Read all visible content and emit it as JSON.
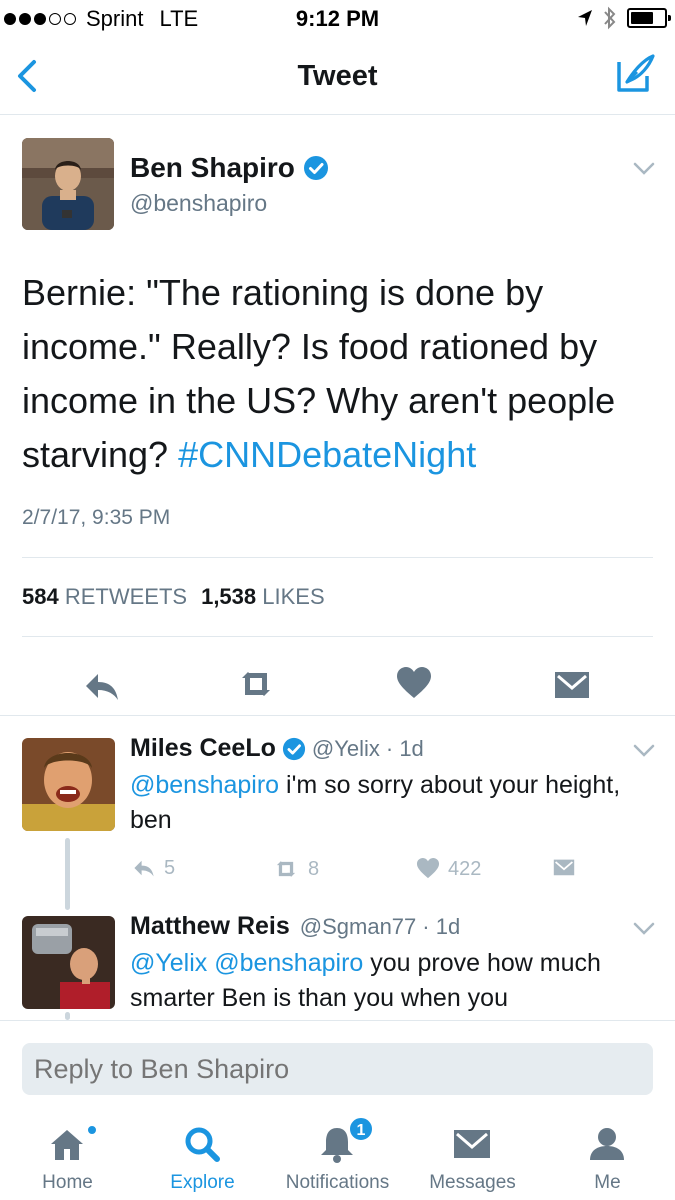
{
  "status_bar": {
    "carrier": "Sprint",
    "network": "LTE",
    "time": "9:12 PM"
  },
  "nav": {
    "title": "Tweet"
  },
  "tweet": {
    "author_name": "Ben Shapiro",
    "author_handle": "@benshapiro",
    "text_main": "Bernie: \"The rationing is done by income.\" Really? Is food rationed by income in the US? Why aren't people starving? ",
    "hashtag": "#CNNDebateNight",
    "timestamp": "2/7/17, 9:35 PM",
    "retweets_count": "584",
    "retweets_label": "RETWEETS",
    "likes_count": "1,538",
    "likes_label": "LIKES"
  },
  "replies": [
    {
      "name": "Miles CeeLo",
      "handle": "@Yelix",
      "age": "· 1d",
      "mention": "@benshapiro",
      "text": " i'm so sorry about your height, ben",
      "reply_count": "5",
      "retweet_count": "8",
      "like_count": "422"
    },
    {
      "name": "Matthew Reis",
      "handle": "@Sgman77",
      "age": "· 1d",
      "mention": "@Yelix @benshapiro",
      "text": " you prove how much smarter Ben is than you when you"
    }
  ],
  "reply_bar": {
    "placeholder": "Reply to Ben Shapiro"
  },
  "tabs": [
    {
      "label": "Home",
      "icon": "home-icon"
    },
    {
      "label": "Explore",
      "icon": "search-icon"
    },
    {
      "label": "Notifications",
      "icon": "bell-icon",
      "badge": "1"
    },
    {
      "label": "Messages",
      "icon": "envelope-icon"
    },
    {
      "label": "Me",
      "icon": "person-icon"
    }
  ],
  "colors": {
    "accent": "#1b95e0",
    "secondary_text": "#657786",
    "icon_gray": "#657786",
    "light_icon": "#aab8c2"
  }
}
